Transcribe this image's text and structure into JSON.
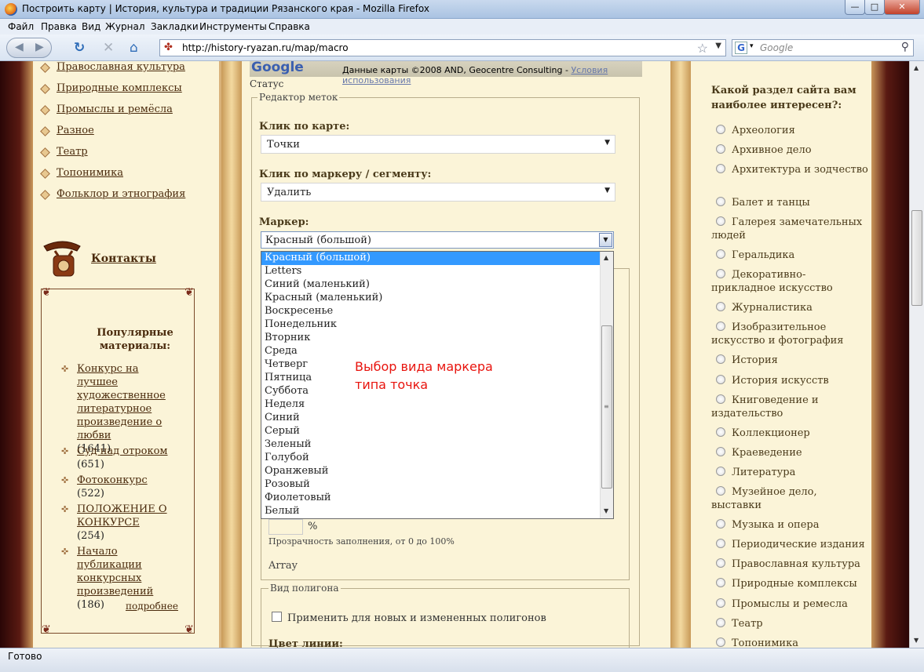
{
  "window": {
    "title": "Построить карту | История, культура и традиции Рязанского края - Mozilla Firefox",
    "min": "—",
    "max": "□",
    "close": "✕"
  },
  "menu": [
    "Файл",
    "Правка",
    "Вид",
    "Журнал",
    "Закладки",
    "Инструменты",
    "Справка"
  ],
  "nav": {
    "url": "http://history-ryazan.ru/map/macro",
    "search_placeholder": "Google",
    "search_engine": "G"
  },
  "left_nav": [
    "Православная культура",
    "Природные комплексы",
    "Промыслы и ремёсла",
    "Разное",
    "Театр",
    "Топонимика",
    "Фольклор и этнография"
  ],
  "contacts": {
    "title": "Контакты"
  },
  "popular": {
    "title": "Популярные материалы:",
    "items": [
      {
        "title": "Конкурс на лучшее художественное литературное произведение о любви",
        "count": "(1641)"
      },
      {
        "title": "Суд над отроком",
        "count": "(651)"
      },
      {
        "title": "Фотоконкурс",
        "count": "(522)"
      },
      {
        "title": "ПОЛОЖЕНИЕ О КОНКУРСЕ",
        "count": "(254)"
      },
      {
        "title": "Начало публикации конкурсных произведений",
        "count": "(186)"
      }
    ],
    "more": "подробнее"
  },
  "map": {
    "logo": "Google",
    "copyright": "Данные карты ©2008 AND, Geocentre Consulting - ",
    "terms": "Условия использования",
    "status_label": "Статус"
  },
  "editor": {
    "legend": "Редактор меток",
    "click_map_label": "Клик по карте:",
    "click_map_value": "Точки",
    "click_marker_label": "Клик по маркеру / сегменту:",
    "click_marker_value": "Удалить",
    "marker_label": "Маркер:",
    "marker_value": "Красный (большой)",
    "marker_options": [
      "Красный (большой)",
      "Letters",
      "Синий (маленький)",
      "Красный (маленький)",
      "Воскресенье",
      "Понедельник",
      "Вторник",
      "Среда",
      "Четверг",
      "Пятница",
      "Суббота",
      "Неделя",
      "Синий",
      "Серый",
      "Зеленый",
      "Голубой",
      "Оранжевый",
      "Розовый",
      "Фиолетовый",
      "Белый"
    ],
    "annotation_line1": "Выбор вида маркера",
    "annotation_line2": "типа точка",
    "pct_sign": "%",
    "fill_hint": "Прозрачность заполнения, от 0 до 100%",
    "array_label": "Array",
    "polygon_legend": "Вид полигона",
    "apply_label": "Применить для новых и измененных полигонов",
    "line_color_label": "Цвет линии:"
  },
  "poll": {
    "question": "Какой раздел сайта вам наиболее интересен?:",
    "options": [
      "Археология",
      "Архивное дело",
      "Архитектура и зодчество",
      "Балет и танцы",
      "Галерея замечательных людей",
      "Геральдика",
      "Декоративно-прикладное искусство",
      "Журналистика",
      "Изобразительное искусство и фотография",
      "История",
      "История искусств",
      "Книговедение и издательство",
      "Коллекционер",
      "Краеведение",
      "Литература",
      "Музейное дело, выставки",
      "Музыка и опера",
      "Периодические издания",
      "Православная культура",
      "Природные комплексы",
      "Промыслы и ремесла",
      "Театр",
      "Топонимика"
    ]
  },
  "status": "Готово",
  "icons": {
    "firefox": "firefox-icon",
    "reload": "reload-icon",
    "stop": "stop-icon",
    "home": "home-icon",
    "bookmark_star": "bookmark-star-icon",
    "search": "search-icon",
    "phone": "telephone-icon"
  }
}
